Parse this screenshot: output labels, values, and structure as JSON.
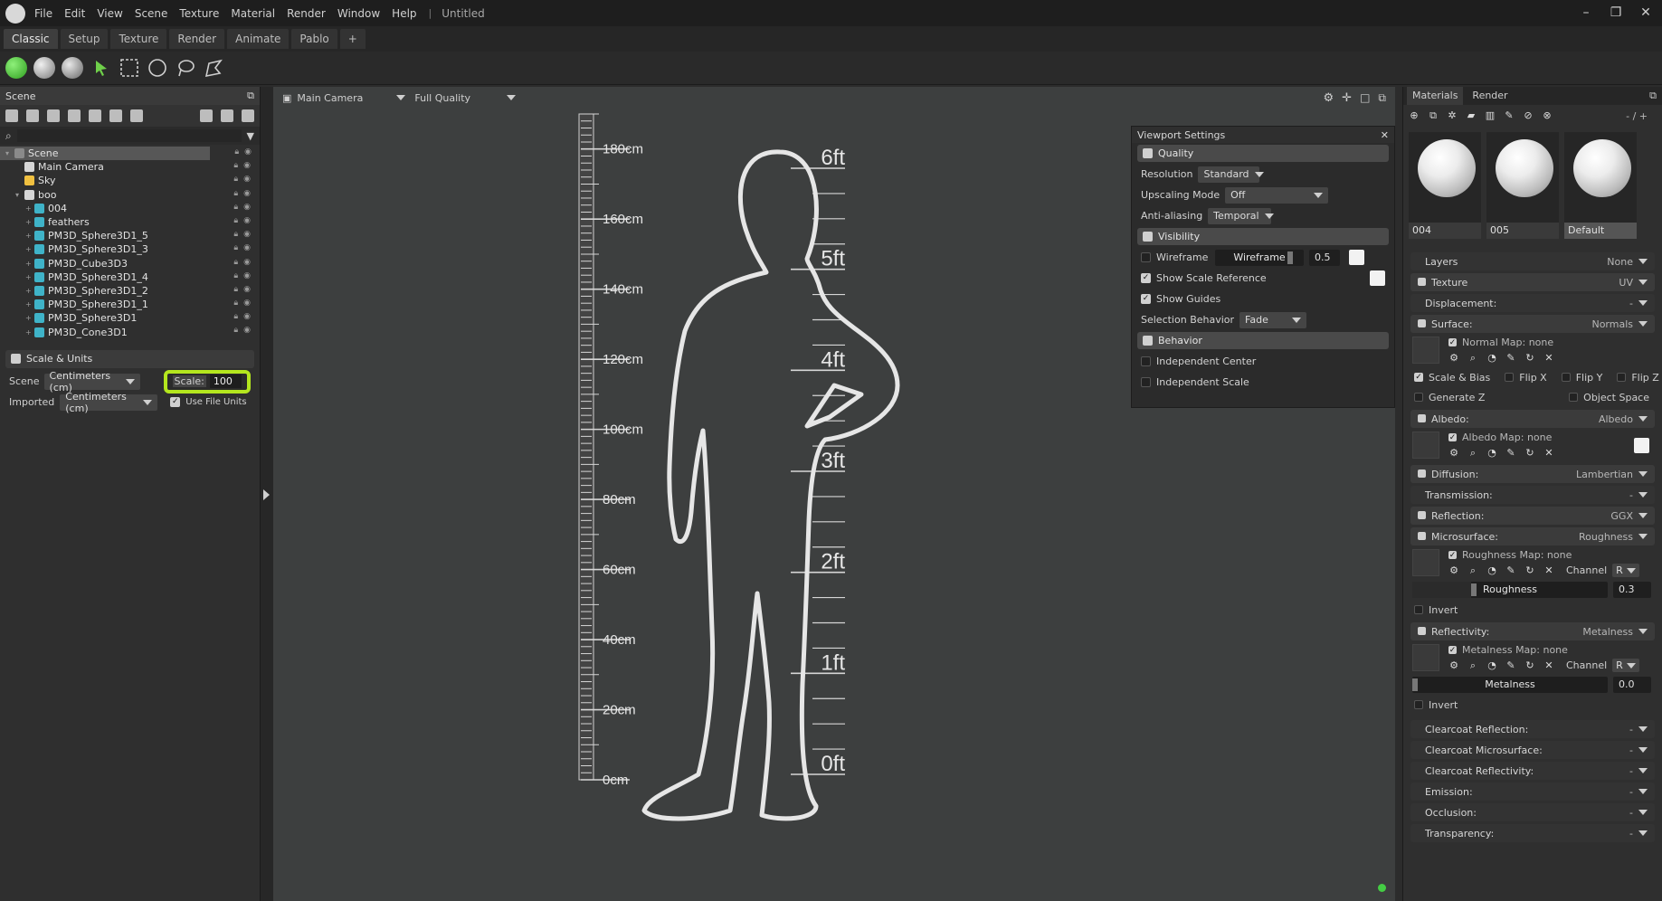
{
  "menubar": {
    "items": [
      "File",
      "Edit",
      "View",
      "Scene",
      "Texture",
      "Material",
      "Render",
      "Window",
      "Help"
    ],
    "separator": "|",
    "doc_title": "Untitled",
    "window_controls": [
      "–",
      "❐",
      "✕"
    ]
  },
  "tabs": [
    "Classic",
    "Setup",
    "Texture",
    "Render",
    "Animate",
    "Pablo",
    "+"
  ],
  "scene_panel": {
    "title": "Scene",
    "tree": [
      {
        "label": "Scene",
        "depth": 0,
        "icon": "scene-icon",
        "color": "#8a8a8a"
      },
      {
        "label": "Main Camera",
        "depth": 1,
        "icon": "camera-icon",
        "color": "#d6d6d6"
      },
      {
        "label": "Sky",
        "depth": 1,
        "icon": "sky-icon",
        "color": "#f0c040"
      },
      {
        "label": "boo",
        "depth": 1,
        "icon": "group-icon",
        "color": "#d6d6d6"
      },
      {
        "label": "004",
        "depth": 2,
        "icon": "mesh-icon",
        "color": "#3fb3c8"
      },
      {
        "label": "feathers",
        "depth": 2,
        "icon": "mesh-icon",
        "color": "#3fb3c8"
      },
      {
        "label": "PM3D_Sphere3D1_5",
        "depth": 2,
        "icon": "mesh-icon",
        "color": "#3fb3c8"
      },
      {
        "label": "PM3D_Sphere3D1_3",
        "depth": 2,
        "icon": "mesh-icon",
        "color": "#3fb3c8"
      },
      {
        "label": "PM3D_Cube3D3",
        "depth": 2,
        "icon": "mesh-icon",
        "color": "#3fb3c8"
      },
      {
        "label": "PM3D_Sphere3D1_4",
        "depth": 2,
        "icon": "mesh-icon",
        "color": "#3fb3c8"
      },
      {
        "label": "PM3D_Sphere3D1_2",
        "depth": 2,
        "icon": "mesh-icon",
        "color": "#3fb3c8"
      },
      {
        "label": "PM3D_Sphere3D1_1",
        "depth": 2,
        "icon": "mesh-icon",
        "color": "#3fb3c8"
      },
      {
        "label": "PM3D_Sphere3D1",
        "depth": 2,
        "icon": "mesh-icon",
        "color": "#3fb3c8"
      },
      {
        "label": "PM3D_Cone3D1",
        "depth": 2,
        "icon": "mesh-icon",
        "color": "#3fb3c8"
      }
    ],
    "scale_units": {
      "title": "Scale & Units",
      "scene_label": "Scene",
      "scene_value": "Centimeters (cm)",
      "scale_label": "Scale:",
      "scale_value": "100",
      "imported_label": "Imported",
      "imported_value": "Centimeters (cm)",
      "use_file_units": "Use File Units"
    }
  },
  "viewport": {
    "camera": "Main Camera",
    "quality": "Full Quality",
    "cm_labels": [
      "180cm",
      "160cm",
      "140cm",
      "120cm",
      "100cm",
      "80cm",
      "60cm",
      "40cm",
      "20cm",
      "0cm"
    ],
    "ft_labels": [
      "6ft",
      "5ft",
      "4ft",
      "3ft",
      "2ft",
      "1ft",
      "0ft"
    ]
  },
  "viewport_settings": {
    "title": "Viewport Settings",
    "quality_header": "Quality",
    "resolution_label": "Resolution",
    "resolution_value": "Standard",
    "upscaling_label": "Upscaling Mode",
    "upscaling_value": "Off",
    "aa_label": "Anti-aliasing",
    "aa_value": "Temporal",
    "visibility_header": "Visibility",
    "wireframe_label": "Wireframe",
    "wireframe_slider": "Wireframe",
    "wireframe_value": "0.5",
    "show_scale_ref": "Show Scale Reference",
    "show_guides": "Show Guides",
    "selection_label": "Selection Behavior",
    "selection_value": "Fade",
    "behavior_header": "Behavior",
    "independent_center": "Independent Center",
    "independent_scale": "Independent Scale"
  },
  "materials_panel": {
    "tabs": [
      "Materials",
      "Render"
    ],
    "counter": "- / +",
    "materials": [
      "004",
      "005",
      "Default"
    ],
    "layers_label": "Layers",
    "layers_value": "None",
    "texture_label": "Texture",
    "texture_value": "UV",
    "displacement_label": "Displacement:",
    "displacement_value": "-",
    "surface_label": "Surface:",
    "surface_value": "Normals",
    "normal_map": "Normal Map: none",
    "scale_bias": "Scale & Bias",
    "flip_x": "Flip X",
    "flip_y": "Flip Y",
    "flip_z": "Flip Z",
    "generate_z": "Generate Z",
    "object_space": "Object Space",
    "albedo_label": "Albedo:",
    "albedo_value": "Albedo",
    "albedo_map": "Albedo Map: none",
    "diffusion_label": "Diffusion:",
    "diffusion_value": "Lambertian",
    "transmission_label": "Transmission:",
    "transmission_value": "-",
    "reflection_label": "Reflection:",
    "reflection_value": "GGX",
    "microsurface_label": "Microsurface:",
    "microsurface_value": "Roughness",
    "roughness_map": "Roughness Map: none",
    "channel_label": "Channel",
    "channel_value": "R",
    "roughness_slider": "Roughness",
    "roughness_value": "0.3",
    "invert_label": "Invert",
    "reflectivity_label": "Reflectivity:",
    "reflectivity_value": "Metalness",
    "metalness_map": "Metalness Map: none",
    "metalness_slider": "Metalness",
    "metalness_value": "0.0",
    "lower_rows": [
      {
        "label": "Clearcoat Reflection:",
        "value": "-"
      },
      {
        "label": "Clearcoat Microsurface:",
        "value": "-"
      },
      {
        "label": "Clearcoat Reflectivity:",
        "value": "-"
      },
      {
        "label": "Emission:",
        "value": "-"
      },
      {
        "label": "Occlusion:",
        "value": "-"
      },
      {
        "label": "Transparency:",
        "value": "-"
      }
    ]
  },
  "colors": {
    "highlight": "#b4e61e",
    "accent_green": "#4caf2e",
    "status_dot": "#44cc44"
  }
}
